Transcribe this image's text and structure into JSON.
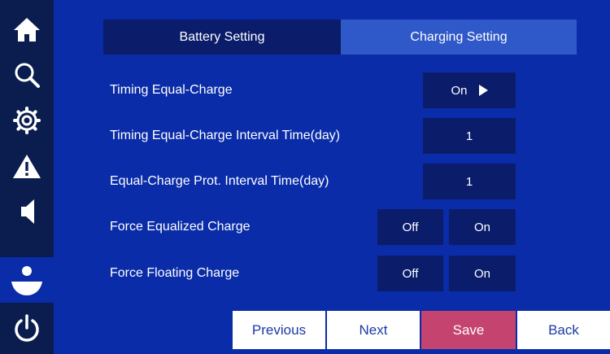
{
  "sidebar": {
    "items": [
      {
        "icon": "home-icon"
      },
      {
        "icon": "search-icon"
      },
      {
        "icon": "gear-icon"
      },
      {
        "icon": "warning-icon"
      },
      {
        "icon": "speaker-icon"
      },
      {
        "icon": "user-icon",
        "active": true
      },
      {
        "icon": "power-icon"
      }
    ]
  },
  "tabs": [
    {
      "label": "Battery Setting",
      "active": false
    },
    {
      "label": "Charging Setting",
      "active": true
    }
  ],
  "settings": {
    "timing_equal_charge": {
      "label": "Timing Equal-Charge",
      "value": "On"
    },
    "interval_time": {
      "label": "Timing Equal-Charge Interval Time(day)",
      "value": "1"
    },
    "prot_interval": {
      "label": "Equal-Charge Prot. Interval Time(day)",
      "value": "1"
    },
    "force_equalized": {
      "label": "Force Equalized Charge",
      "off_label": "Off",
      "on_label": "On"
    },
    "force_floating": {
      "label": "Force Floating Charge",
      "off_label": "Off",
      "on_label": "On"
    }
  },
  "footer": {
    "previous": "Previous",
    "next": "Next",
    "save": "Save",
    "back": "Back"
  },
  "colors": {
    "background": "#0a2ca8",
    "sidebar": "#0b1d4f",
    "value_box": "#0b1d6a",
    "active_tab": "#2f58c8",
    "save_button": "#c4436f"
  }
}
